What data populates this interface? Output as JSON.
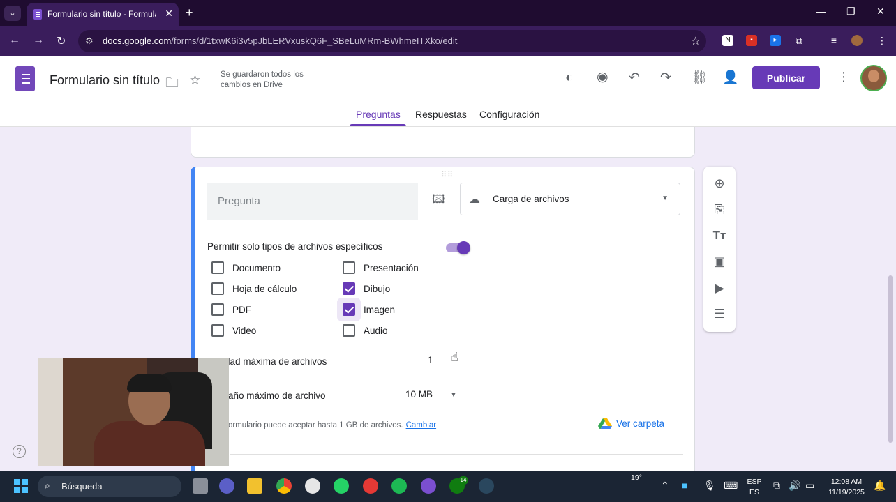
{
  "browser": {
    "tab_title": "Formulario sin título - Formular",
    "url_host": "docs.google.com",
    "url_path": "/forms/d/1txwK6i3v5pJbLERVxuskQ6F_SBeLuMRm-BWhmeITXko/edit"
  },
  "header": {
    "title": "Formulario sin título",
    "saved_status": "Se guardaron todos los cambios en Drive",
    "publish_label": "Publicar",
    "tabs": [
      "Preguntas",
      "Respuestas",
      "Configuración"
    ],
    "active_tab": "Preguntas",
    "accent_color": "#673ab7"
  },
  "question": {
    "placeholder": "Pregunta",
    "type": "Carga de archivos",
    "allow_specific_label": "Permitir solo tipos de archivos específicos",
    "allow_specific_enabled": true,
    "file_types": [
      {
        "label": "Documento",
        "checked": false
      },
      {
        "label": "Presentación",
        "checked": false
      },
      {
        "label": "Hoja de cálculo",
        "checked": false
      },
      {
        "label": "Dibujo",
        "checked": true
      },
      {
        "label": "PDF",
        "checked": false
      },
      {
        "label": "Imagen",
        "checked": true
      },
      {
        "label": "Video",
        "checked": false
      },
      {
        "label": "Audio",
        "checked": false
      }
    ],
    "max_files_label": "idad máxima de archivos",
    "max_files_value": "1",
    "max_size_label": "año máximo de archivo",
    "max_size_value": "10 MB",
    "limit_hint": "ormulario puede aceptar hasta 1 GB de archivos.",
    "change_link": "Cambiar",
    "view_folder": "Ver carpeta"
  },
  "side_toolbar": [
    "add-question-icon",
    "import-questions-icon",
    "add-title-icon",
    "add-image-icon",
    "add-video-icon",
    "add-section-icon"
  ],
  "taskbar": {
    "search_placeholder": "Búsqueda",
    "weather": "19°",
    "lang_top": "ESP",
    "lang_bottom": "ES",
    "time": "12:08 AM",
    "date": "11/19/2025",
    "xbox_badge": "14"
  }
}
